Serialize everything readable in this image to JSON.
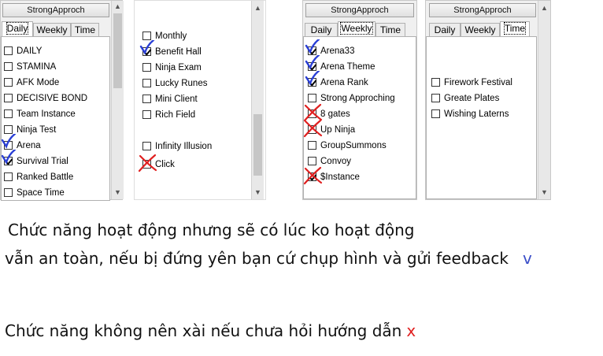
{
  "panel1": {
    "title": "StrongApproch",
    "tabs": [
      "Daily",
      "Weekly",
      "Time"
    ],
    "items": [
      {
        "label": "DAILY",
        "checked": false,
        "mark": ""
      },
      {
        "label": "STAMINA",
        "checked": false,
        "mark": ""
      },
      {
        "label": "AFK Mode",
        "checked": false,
        "mark": ""
      },
      {
        "label": "DECISIVE BOND",
        "checked": false,
        "mark": ""
      },
      {
        "label": "Team Instance",
        "checked": false,
        "mark": ""
      },
      {
        "label": "Ninja Test",
        "checked": false,
        "mark": ""
      },
      {
        "label": "Arena",
        "checked": false,
        "mark": "v"
      },
      {
        "label": "Survival Trial",
        "checked": true,
        "mark": "v"
      },
      {
        "label": "Ranked Battle",
        "checked": false,
        "mark": ""
      },
      {
        "label": "Space Time",
        "checked": false,
        "mark": ""
      }
    ]
  },
  "panel2": {
    "items": [
      {
        "label": "Monthly",
        "checked": false,
        "mark": ""
      },
      {
        "label": "Benefit Hall",
        "checked": true,
        "mark": "v"
      },
      {
        "label": "Ninja Exam",
        "checked": false,
        "mark": ""
      },
      {
        "label": "Lucky Runes",
        "checked": false,
        "mark": ""
      },
      {
        "label": "Mini Client",
        "checked": false,
        "mark": ""
      },
      {
        "label": "Rich Field",
        "checked": false,
        "mark": ""
      },
      {
        "label": "Infinity Illusion",
        "checked": false,
        "mark": ""
      },
      {
        "label": "Click",
        "checked": false,
        "mark": "x"
      }
    ]
  },
  "panel3": {
    "title": "StrongApproch",
    "tabs": [
      "Daily",
      "Weekly",
      "Time"
    ],
    "items": [
      {
        "label": "Arena33",
        "checked": true,
        "mark": "v"
      },
      {
        "label": "Arena Theme",
        "checked": true,
        "mark": "v"
      },
      {
        "label": "Arena Rank",
        "checked": true,
        "mark": "v"
      },
      {
        "label": "Strong Approching",
        "checked": false,
        "mark": ""
      },
      {
        "label": "8 gates",
        "checked": false,
        "mark": "x"
      },
      {
        "label": "Up Ninja",
        "checked": false,
        "mark": "x"
      },
      {
        "label": "GroupSummons",
        "checked": false,
        "mark": ""
      },
      {
        "label": "Convoy",
        "checked": false,
        "mark": ""
      },
      {
        "label": "$Instance",
        "checked": true,
        "mark": "x"
      }
    ]
  },
  "panel4": {
    "title": "StrongApproch",
    "tabs": [
      "Daily",
      "Weekly",
      "Time"
    ],
    "items": [
      {
        "label": "Firework Festival",
        "checked": false,
        "mark": ""
      },
      {
        "label": "Greate Plates",
        "checked": false,
        "mark": ""
      },
      {
        "label": "Wishing Laterns",
        "checked": false,
        "mark": ""
      }
    ]
  },
  "notes": {
    "line1": "Chức năng hoạt động nhưng sẽ có lúc ko hoạt động",
    "line2": "vẫn an toàn, nếu bị đứng yên bạn cứ chụp hình và gửi feedback",
    "line2_marker": "v",
    "line3": "Chức năng không nên xài nếu chưa hỏi hướng dẫn",
    "line3_marker": "x"
  },
  "colors": {
    "check_mark": "#2a3fd6",
    "cross_mark": "#e02020",
    "marker_v": "#3a4ec8",
    "marker_x": "#e02020"
  }
}
